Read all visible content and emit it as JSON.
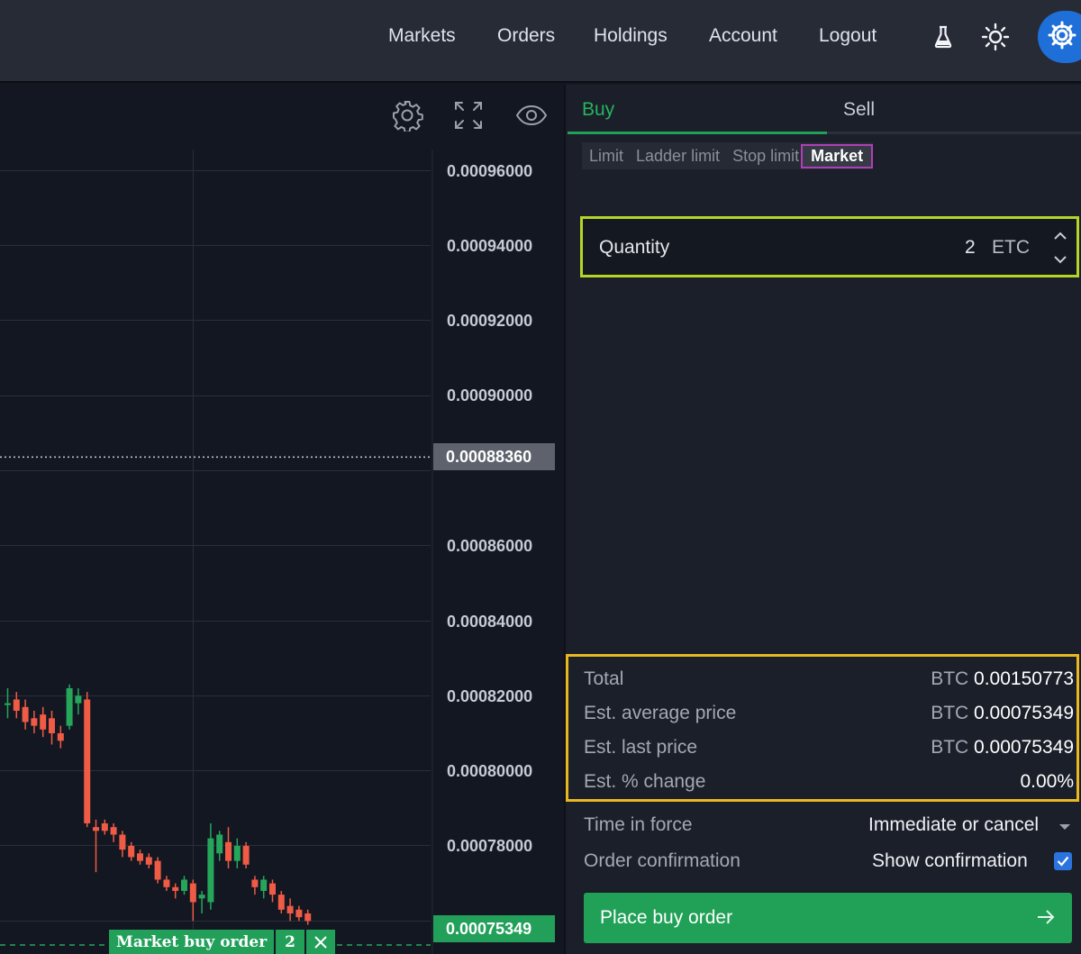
{
  "nav": {
    "links": [
      "Markets",
      "Orders",
      "Holdings",
      "Account",
      "Logout"
    ],
    "icons": [
      "flask-icon",
      "sun-icon",
      "gear-icon"
    ]
  },
  "chart": {
    "tools": [
      "settings-icon",
      "fullscreen-icon",
      "eye-icon"
    ],
    "ticks": [
      "0.00096000",
      "0.00094000",
      "0.00092000",
      "0.00090000",
      "0.00086000",
      "0.00084000",
      "0.00082000",
      "0.00080000",
      "0.00078000"
    ],
    "current_price": "0.00088360",
    "order_price": "0.00075349",
    "order_label": "Market buy order",
    "order_qty": "2",
    "colors": {
      "up": "#26a65b",
      "down": "#ef5b45",
      "background": "#131722"
    }
  },
  "chart_data": {
    "type": "candlestick",
    "y_axis_ticks": [
      0.00096,
      0.00094,
      0.00092,
      0.0009,
      0.00088,
      0.00086,
      0.00084,
      0.00082,
      0.0008,
      0.00078
    ],
    "last_price_marker": 0.0008836,
    "order_line_price": 0.00075349,
    "candles": [
      {
        "o": 0.000818,
        "c": 0.000818,
        "h": 0.000822,
        "l": 0.000814
      },
      {
        "o": 0.000819,
        "c": 0.000816,
        "h": 0.000821,
        "l": 0.000814
      },
      {
        "o": 0.000817,
        "c": 0.000813,
        "h": 0.000819,
        "l": 0.000811
      },
      {
        "o": 0.000814,
        "c": 0.000812,
        "h": 0.000816,
        "l": 0.00081
      },
      {
        "o": 0.000815,
        "c": 0.000811,
        "h": 0.000817,
        "l": 0.000809
      },
      {
        "o": 0.000814,
        "c": 0.00081,
        "h": 0.000816,
        "l": 0.000807
      },
      {
        "o": 0.00081,
        "c": 0.000808,
        "h": 0.000812,
        "l": 0.000806
      },
      {
        "o": 0.000812,
        "c": 0.000822,
        "h": 0.000823,
        "l": 0.000811
      },
      {
        "o": 0.000818,
        "c": 0.00082,
        "h": 0.000822,
        "l": 0.000815
      },
      {
        "o": 0.000819,
        "c": 0.000786,
        "h": 0.000821,
        "l": 0.000785
      },
      {
        "o": 0.000785,
        "c": 0.000784,
        "h": 0.000787,
        "l": 0.000773
      },
      {
        "o": 0.000786,
        "c": 0.000784,
        "h": 0.000787,
        "l": 0.000783
      },
      {
        "o": 0.000785,
        "c": 0.000783,
        "h": 0.000786,
        "l": 0.000781
      },
      {
        "o": 0.000783,
        "c": 0.000779,
        "h": 0.000784,
        "l": 0.000777
      },
      {
        "o": 0.00078,
        "c": 0.000777,
        "h": 0.000781,
        "l": 0.000776
      },
      {
        "o": 0.000778,
        "c": 0.000776,
        "h": 0.000779,
        "l": 0.000775
      },
      {
        "o": 0.000777,
        "c": 0.000775,
        "h": 0.000778,
        "l": 0.000774
      },
      {
        "o": 0.000776,
        "c": 0.000771,
        "h": 0.000777,
        "l": 0.00077
      },
      {
        "o": 0.000771,
        "c": 0.000769,
        "h": 0.000772,
        "l": 0.000768
      },
      {
        "o": 0.000769,
        "c": 0.000768,
        "h": 0.00077,
        "l": 0.000766
      },
      {
        "o": 0.000768,
        "c": 0.000771,
        "h": 0.000772,
        "l": 0.000767
      },
      {
        "o": 0.00077,
        "c": 0.000765,
        "h": 0.000771,
        "l": 0.00076
      },
      {
        "o": 0.000766,
        "c": 0.000767,
        "h": 0.000768,
        "l": 0.000762
      },
      {
        "o": 0.000765,
        "c": 0.000782,
        "h": 0.000786,
        "l": 0.000763
      },
      {
        "o": 0.000778,
        "c": 0.000783,
        "h": 0.000784,
        "l": 0.000776
      },
      {
        "o": 0.000781,
        "c": 0.000776,
        "h": 0.000785,
        "l": 0.000774
      },
      {
        "o": 0.000776,
        "c": 0.00078,
        "h": 0.000782,
        "l": 0.000774
      },
      {
        "o": 0.00078,
        "c": 0.000775,
        "h": 0.000781,
        "l": 0.000774
      },
      {
        "o": 0.000771,
        "c": 0.000769,
        "h": 0.000772,
        "l": 0.000767
      },
      {
        "o": 0.000768,
        "c": 0.000771,
        "h": 0.000772,
        "l": 0.000766
      },
      {
        "o": 0.00077,
        "c": 0.000767,
        "h": 0.000771,
        "l": 0.000765
      },
      {
        "o": 0.000767,
        "c": 0.000763,
        "h": 0.000768,
        "l": 0.000762
      },
      {
        "o": 0.000764,
        "c": 0.000762,
        "h": 0.000766,
        "l": 0.00076
      },
      {
        "o": 0.000763,
        "c": 0.000761,
        "h": 0.000764,
        "l": 0.00076
      },
      {
        "o": 0.000762,
        "c": 0.00076,
        "h": 0.000763,
        "l": 0.000759
      }
    ]
  },
  "panel": {
    "tabs": [
      "Buy",
      "Sell"
    ],
    "order_types": [
      "Limit",
      "Ladder limit",
      "Stop limit",
      "Market"
    ],
    "quantity": {
      "label": "Quantity",
      "value": "2",
      "unit": "ETC"
    },
    "summary": [
      {
        "label": "Total",
        "currency": "BTC",
        "value": "0.00150773"
      },
      {
        "label": "Est. average price",
        "currency": "BTC",
        "value": "0.00075349"
      },
      {
        "label": "Est. last price",
        "currency": "BTC",
        "value": "0.00075349"
      },
      {
        "label": "Est. % change",
        "currency": "",
        "value": "0.00%"
      }
    ],
    "time_in_force": {
      "label": "Time in force",
      "value": "Immediate or cancel"
    },
    "order_confirmation": {
      "label": "Order confirmation",
      "value": "Show confirmation",
      "checked": true
    },
    "place_button": "Place buy order"
  }
}
